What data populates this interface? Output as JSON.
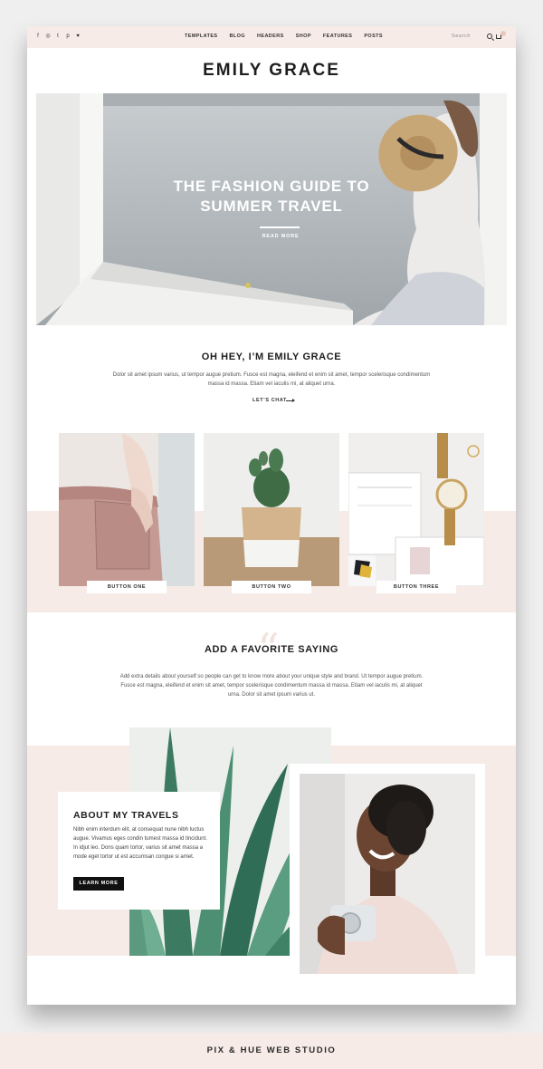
{
  "header": {
    "social_icons": [
      "facebook-icon",
      "instagram-icon",
      "twitter-icon",
      "pinterest-icon",
      "heart-icon"
    ],
    "nav": [
      "TEMPLATES",
      "BLOG",
      "HEADERS",
      "SHOP",
      "FEATURES",
      "POSTS"
    ],
    "search_label": "Search"
  },
  "logo": "EMILY GRACE",
  "hero": {
    "title_line1": "THE FASHION GUIDE TO",
    "title_line2": "SUMMER TRAVEL",
    "link": "READ MORE"
  },
  "intro": {
    "title": "OH HEY, I’M EMILY GRACE",
    "text": "Dolor sit amet ipsum varius, ut tempor augue pretium. Fusce est magna, eleifend et enim sit amet, tempor scelerisque condimentum massa id massa. Etiam vel iaculis mi, at aliquet urna.",
    "cta": "LET’S CHAT"
  },
  "features": [
    {
      "button": "BUTTON ONE"
    },
    {
      "button": "BUTTON TWO"
    },
    {
      "button": "BUTTON THREE"
    }
  ],
  "saying": {
    "title": "ADD A FAVORITE SAYING",
    "text": "Add extra details about yourself so people can get to know more about your unique style and brand. Ut tempor augue pretium. Fusce est magna, eleifend et enim sit amet, tempor scelerisque condimentum massa id massa. Etiam vel iaculis mi, at aliquet urna. Dolor sit amet ipsum varius ut."
  },
  "about": {
    "title": "ABOUT MY TRAVELS",
    "text": "Nibh enim interdum elit, at consequat nune nibh luctus augue. Vivamus eges condin tumest massa id tincidunt. In idjut leo. Dons quam tortor, varius sit amet massa a mode eget tortor ut est accumsan congue si amet.",
    "button": "LEARN MORE"
  },
  "footer": "PIX & HUE WEB STUDIO",
  "colors": {
    "blush": "#f7ebe7",
    "background": "#f0efef",
    "text": "#1e1e1e"
  }
}
